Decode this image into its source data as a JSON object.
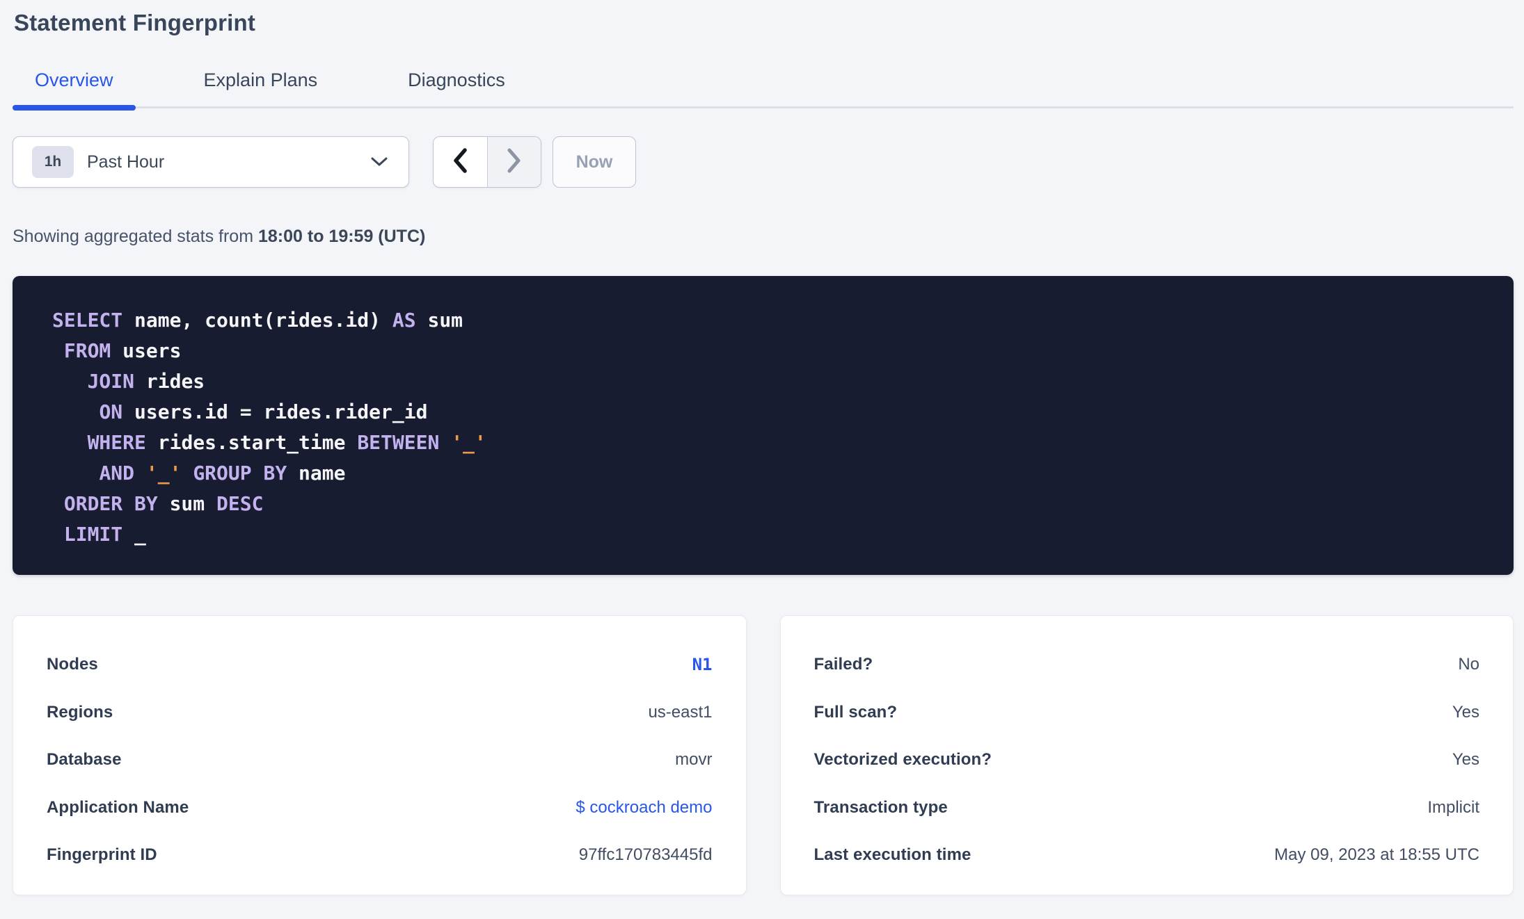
{
  "page": {
    "title": "Statement Fingerprint"
  },
  "tabs": [
    {
      "label": "Overview",
      "active": true
    },
    {
      "label": "Explain Plans",
      "active": false
    },
    {
      "label": "Diagnostics",
      "active": false
    }
  ],
  "time_picker": {
    "interval_badge": "1h",
    "selected_range": "Past Hour",
    "now_label": "Now"
  },
  "stats_line": {
    "prefix": "Showing aggregated stats from ",
    "range": "18:00 to 19:59 (UTC)"
  },
  "sql": {
    "lines": [
      [
        [
          "SELECT",
          "kw"
        ],
        [
          " name, count(rides.id) ",
          "pl"
        ],
        [
          "AS",
          "kw"
        ],
        [
          " sum",
          "pl"
        ]
      ],
      [
        [
          " ",
          "pl"
        ],
        [
          "FROM",
          "kw"
        ],
        [
          " users",
          "pl"
        ]
      ],
      [
        [
          "   ",
          "pl"
        ],
        [
          "JOIN",
          "kw"
        ],
        [
          " rides",
          "pl"
        ]
      ],
      [
        [
          "    ",
          "pl"
        ],
        [
          "ON",
          "kw"
        ],
        [
          " users.id = rides.rider_id",
          "pl"
        ]
      ],
      [
        [
          "   ",
          "pl"
        ],
        [
          "WHERE",
          "kw"
        ],
        [
          " rides.start_time ",
          "pl"
        ],
        [
          "BETWEEN",
          "kw"
        ],
        [
          " ",
          "pl"
        ],
        [
          "'_'",
          "str"
        ]
      ],
      [
        [
          "    ",
          "pl"
        ],
        [
          "AND",
          "kw"
        ],
        [
          " ",
          "pl"
        ],
        [
          "'_'",
          "str"
        ],
        [
          " ",
          "pl"
        ],
        [
          "GROUP BY",
          "kw"
        ],
        [
          " name",
          "pl"
        ]
      ],
      [
        [
          " ",
          "pl"
        ],
        [
          "ORDER BY",
          "kw"
        ],
        [
          " sum ",
          "pl"
        ],
        [
          "DESC",
          "kw"
        ]
      ],
      [
        [
          " ",
          "pl"
        ],
        [
          "LIMIT",
          "kw"
        ],
        [
          " _",
          "pl"
        ]
      ]
    ]
  },
  "cards": {
    "left": {
      "rows": [
        {
          "label": "Nodes",
          "value": "N1",
          "link": true,
          "mono": true
        },
        {
          "label": "Regions",
          "value": "us-east1",
          "link": false,
          "mono": false
        },
        {
          "label": "Database",
          "value": "movr",
          "link": false,
          "mono": false
        },
        {
          "label": "Application Name",
          "value": "$ cockroach demo",
          "link": true,
          "mono": false
        },
        {
          "label": "Fingerprint ID",
          "value": "97ffc170783445fd",
          "link": false,
          "mono": false
        }
      ]
    },
    "right": {
      "rows": [
        {
          "label": "Failed?",
          "value": "No",
          "link": false,
          "mono": false
        },
        {
          "label": "Full scan?",
          "value": "Yes",
          "link": false,
          "mono": false
        },
        {
          "label": "Vectorized execution?",
          "value": "Yes",
          "link": false,
          "mono": false
        },
        {
          "label": "Transaction type",
          "value": "Implicit",
          "link": false,
          "mono": false
        },
        {
          "label": "Last execution time",
          "value": "May 09, 2023 at 18:55 UTC",
          "link": false,
          "mono": false
        }
      ]
    }
  },
  "colors": {
    "accent_blue": "#2a56e8",
    "code_background": "#171c31",
    "code_keyword": "#c4b2ee",
    "code_plain": "#f5f5f8",
    "code_string": "#e89c4a",
    "page_background": "#f4f5f8"
  }
}
